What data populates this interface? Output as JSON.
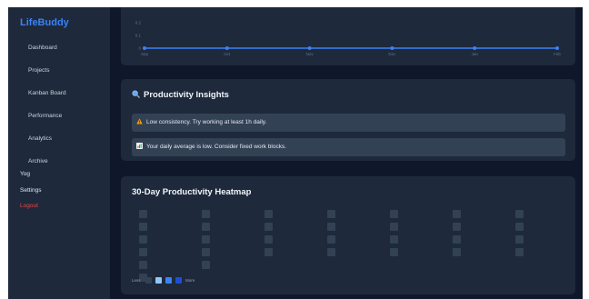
{
  "sidebar": {
    "brand": "LifeBuddy",
    "items": [
      {
        "label": "Dashboard",
        "name": "sidebar-item-dashboard"
      },
      {
        "label": "Projects",
        "name": "sidebar-item-projects"
      },
      {
        "label": "Kanban Board",
        "name": "sidebar-item-kanban-board"
      },
      {
        "label": "Performance",
        "name": "sidebar-item-performance"
      },
      {
        "label": "Analytics",
        "name": "sidebar-item-analytics"
      },
      {
        "label": "Archive",
        "name": "sidebar-item-archive"
      }
    ],
    "extra": {
      "yog": "Yog",
      "settings": "Settings",
      "logout": "Logout"
    }
  },
  "trend_chart": {
    "type": "line",
    "categories": [
      "Sep",
      "Oct",
      "Nov",
      "Dec",
      "Jan",
      "Feb"
    ],
    "values": [
      0,
      0,
      0,
      0,
      0,
      0
    ],
    "y_ticks": [
      "0.2",
      "0.1",
      "0"
    ],
    "color": "#3b82f6"
  },
  "insights": {
    "title": "Productivity Insights",
    "icon": "magnifier-icon",
    "items": [
      {
        "icon": "warning-icon",
        "text": "Low consistency. Try working at least 1h daily."
      },
      {
        "icon": "chart-icon",
        "text": "Your daily average is low. Consider fixed work blocks."
      }
    ]
  },
  "heatmap": {
    "title": "30-Day Productivity Heatmap",
    "columns": [
      [
        0,
        0,
        0,
        0,
        0,
        0
      ],
      [
        0,
        0,
        0,
        0,
        0
      ],
      [
        0,
        0,
        0,
        0
      ],
      [
        0,
        0,
        0,
        0
      ],
      [
        0,
        0,
        0,
        0
      ],
      [
        0,
        0,
        0,
        0
      ],
      [
        0,
        0,
        0,
        0
      ]
    ],
    "legend": {
      "less": "Less",
      "more": "More",
      "colors": [
        "#334155",
        "#93c5fd",
        "#3b82f6",
        "#1d4ed8"
      ]
    }
  }
}
